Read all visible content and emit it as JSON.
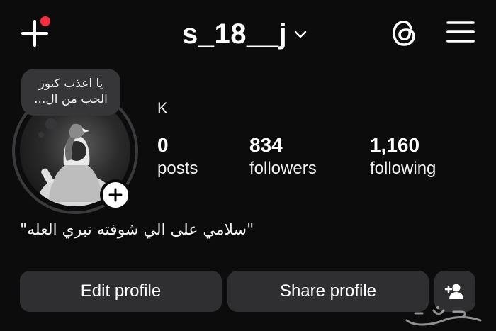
{
  "header": {
    "username": "s_18__j",
    "create_icon": "plus-icon",
    "dropdown_icon": "chevron-down-icon",
    "threads_icon": "threads-icon",
    "menu_icon": "hamburger-menu-icon",
    "notification_color": "#ff2d3f"
  },
  "profile": {
    "note": "يا اعذب كنوز\nالحب من ال...",
    "display_name": "K",
    "add_story_icon": "plus-icon",
    "bio": "\"سلامي على الي شوفته تبري العله\""
  },
  "stats": [
    {
      "value": "0",
      "label": "posts"
    },
    {
      "value": "834",
      "label": "followers"
    },
    {
      "value": "1,160",
      "label": "following"
    }
  ],
  "actions": {
    "edit_label": "Edit profile",
    "share_label": "Share profile",
    "suggest_icon": "add-person-icon"
  },
  "watermark": {
    "text": "حراج"
  },
  "colors": {
    "background": "#0c0c0d",
    "button": "#2f2f31",
    "note_bubble": "#363638"
  }
}
